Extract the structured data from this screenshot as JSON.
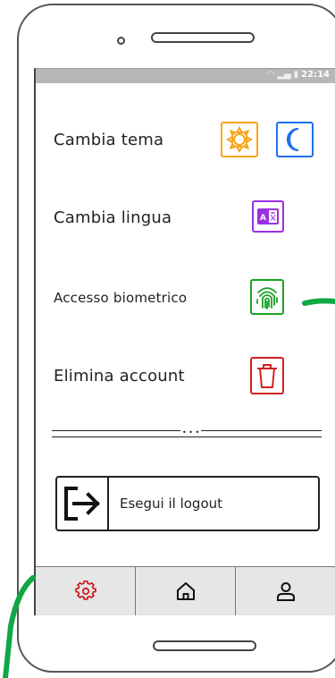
{
  "status": {
    "time": "22:14"
  },
  "settings": {
    "theme_label": "Cambia tema",
    "language_label": "Cambia lingua",
    "biometric_label": "Accesso biometrico",
    "delete_label": "Elimina account"
  },
  "logout": {
    "label": "Esegui il logout"
  },
  "colors": {
    "sun": "#f7a41b",
    "moon": "#1e6ff0",
    "language": "#9b30e0",
    "fingerprint": "#1aa324",
    "trash": "#d22020",
    "gear": "#cc1e1e",
    "annotation": "#0fa845"
  },
  "icons": {
    "theme_light": "sun-icon",
    "theme_dark": "moon-icon",
    "language": "translate-icon",
    "biometric": "fingerprint-icon",
    "delete": "trash-icon",
    "logout": "logout-icon",
    "tab_settings": "gear-icon",
    "tab_home": "home-icon",
    "tab_profile": "user-icon"
  }
}
